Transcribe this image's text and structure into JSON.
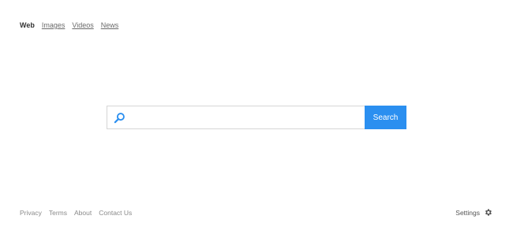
{
  "nav": {
    "items": [
      {
        "label": "Web"
      },
      {
        "label": "Images"
      },
      {
        "label": "Videos"
      },
      {
        "label": "News"
      }
    ],
    "active": "Web"
  },
  "search": {
    "value": "",
    "placeholder": "",
    "button_label": "Search",
    "icon": "search-icon"
  },
  "footer": {
    "links": [
      {
        "label": "Privacy"
      },
      {
        "label": "Terms"
      },
      {
        "label": "About"
      },
      {
        "label": "Contact Us"
      }
    ],
    "settings_label": "Settings",
    "settings_icon": "gear-icon"
  },
  "colors": {
    "accent": "#2b8ff0",
    "border": "#d6d6d6",
    "nav_text": "#6b6b6b",
    "footer_text": "#8a8a8a"
  }
}
